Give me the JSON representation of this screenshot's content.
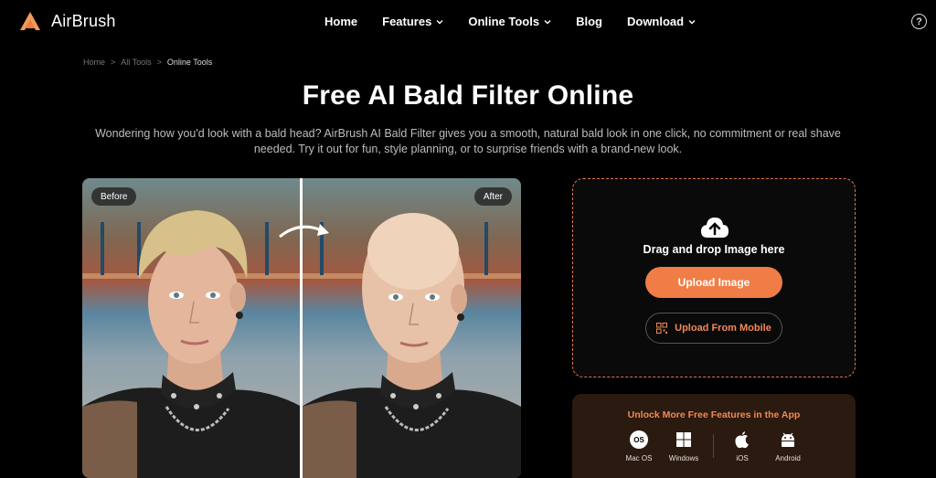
{
  "header": {
    "brand": "AirBrush",
    "nav": [
      {
        "label": "Home",
        "has_dropdown": false
      },
      {
        "label": "Features",
        "has_dropdown": true
      },
      {
        "label": "Online Tools",
        "has_dropdown": true
      },
      {
        "label": "Blog",
        "has_dropdown": false
      },
      {
        "label": "Download",
        "has_dropdown": true
      }
    ],
    "help_icon": "?"
  },
  "breadcrumb": [
    "Home",
    "All Tools",
    "Online Tools"
  ],
  "breadcrumb_sep": ">",
  "hero": {
    "title": "Free AI Bald Filter Online",
    "description": "Wondering how you'd look with a bald head? AirBrush AI Bald Filter gives you a smooth, natural bald look in one click, no commitment or real shave needed. Try it out for fun, style planning, or to surprise friends with a brand-new look."
  },
  "compare": {
    "before_label": "Before",
    "after_label": "After"
  },
  "upload": {
    "icon": "cloud-upload-icon",
    "drag_text": "Drag and drop Image here",
    "upload_button": "Upload Image",
    "mobile_button": "Upload From Mobile"
  },
  "app_promo": {
    "title": "Unlock More Free Features in the App",
    "platforms": [
      {
        "label": "Mac OS",
        "icon": "macos-icon",
        "badge": "OS"
      },
      {
        "label": "Windows",
        "icon": "windows-icon"
      },
      {
        "label": "iOS",
        "icon": "apple-icon"
      },
      {
        "label": "Android",
        "icon": "android-icon"
      }
    ]
  },
  "colors": {
    "accent": "#f07d46",
    "background": "#000000",
    "promo_bg": "#2b1a10"
  }
}
